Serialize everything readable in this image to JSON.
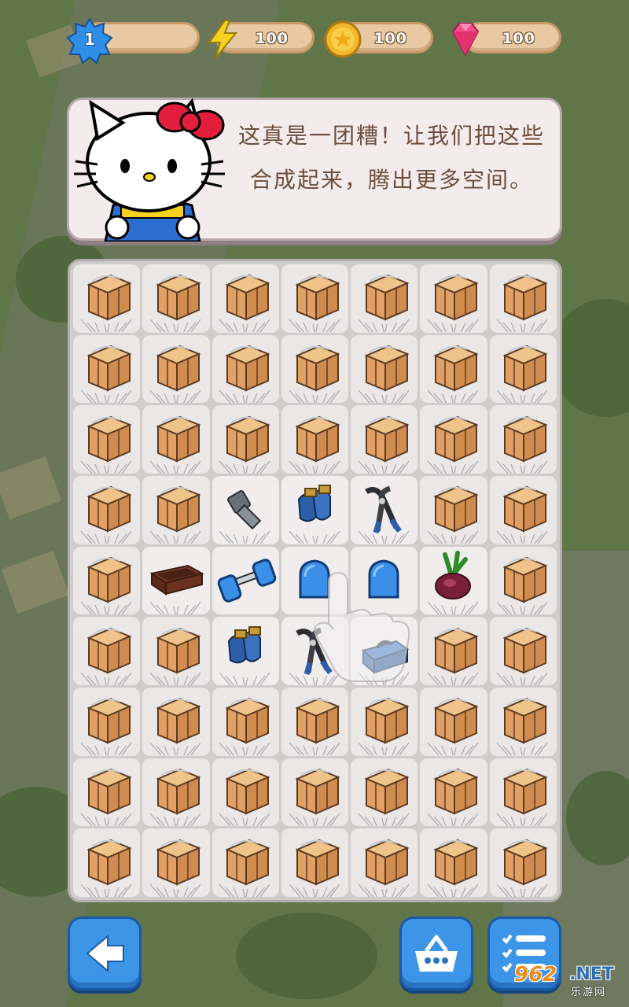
{
  "hud": {
    "level": "1",
    "energy": "100",
    "coins": "100",
    "gems": "100"
  },
  "dialog": {
    "text": "这真是一团糟！让我们把这些合成起来，腾出更多空间。"
  },
  "board": {
    "rows": [
      [
        "crate",
        "crate",
        "crate",
        "crate",
        "crate",
        "crate",
        "crate"
      ],
      [
        "crate",
        "crate",
        "crate",
        "crate",
        "crate",
        "crate",
        "crate"
      ],
      [
        "crate",
        "crate",
        "crate",
        "crate",
        "crate",
        "crate",
        "crate"
      ],
      [
        "crate",
        "crate",
        "bolt",
        "gloves",
        "pliers",
        "crate",
        "crate"
      ],
      [
        "crate",
        "planter-box",
        "dumbbell",
        "blue-block",
        "blue-block",
        "onion",
        "crate"
      ],
      [
        "crate",
        "crate",
        "gloves",
        "pliers",
        "toolbox",
        "crate",
        "crate"
      ],
      [
        "crate",
        "crate",
        "crate",
        "crate",
        "crate",
        "crate",
        "crate"
      ],
      [
        "crate",
        "crate",
        "crate",
        "crate",
        "crate",
        "crate",
        "crate"
      ],
      [
        "crate",
        "crate",
        "crate",
        "crate",
        "crate",
        "crate",
        "crate"
      ]
    ]
  },
  "buttons": {
    "back": "back-arrow-icon",
    "shop": "basket-icon",
    "tasks": "checklist-icon"
  },
  "watermark": {
    "number": "962",
    "net": ".NET",
    "sub": "乐游网"
  },
  "colors": {
    "button_blue": "#3c95e6",
    "pill": "#e8c9a3",
    "dialog_text": "#6b4e3e"
  }
}
